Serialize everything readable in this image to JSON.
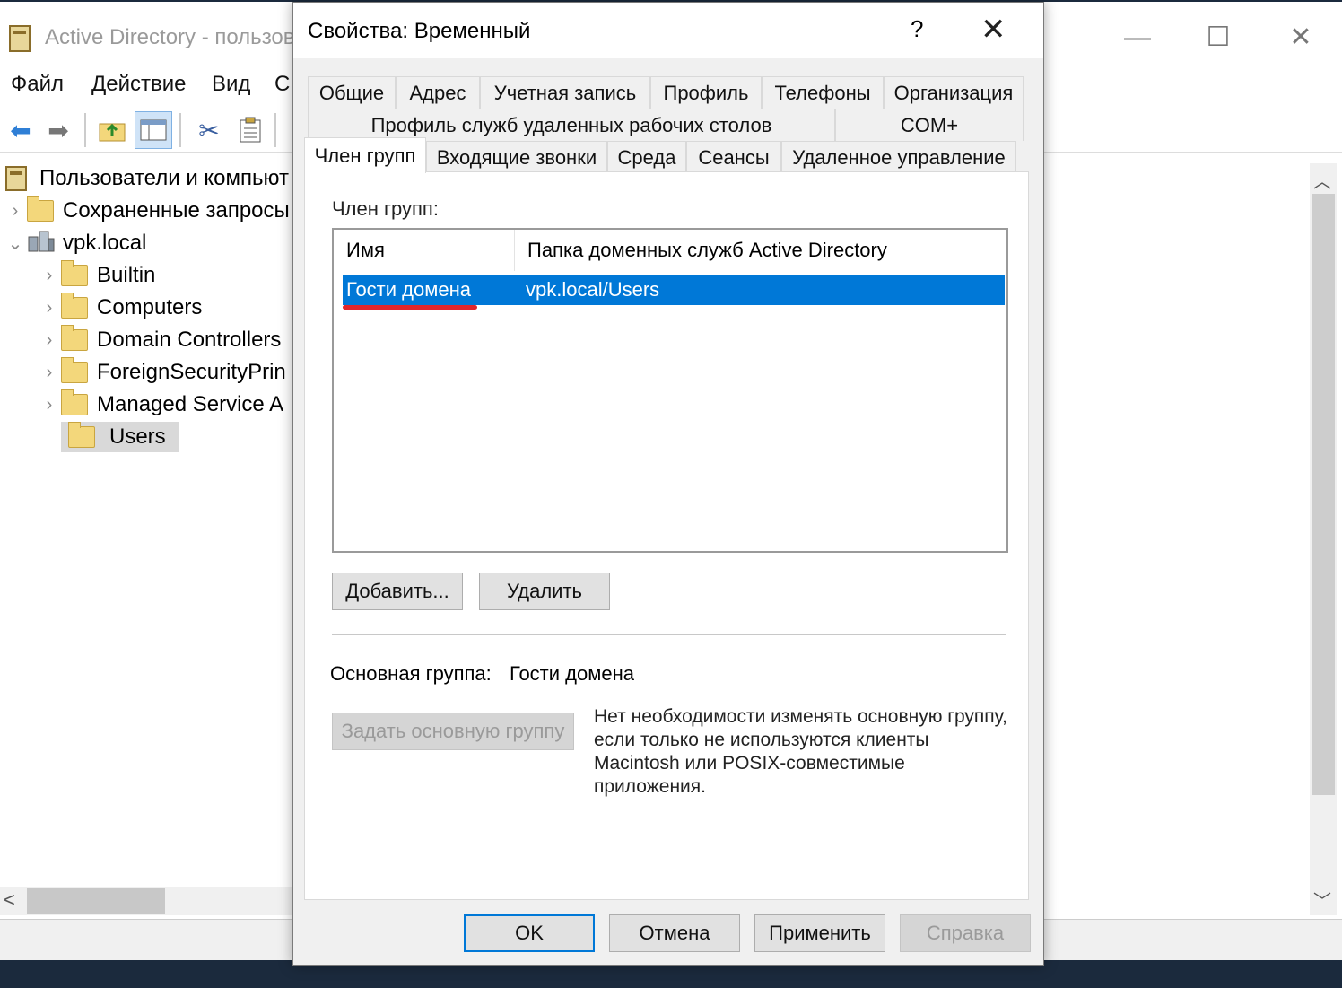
{
  "main_window": {
    "title": "Active Directory - пользов",
    "controls": {
      "minimize": "—",
      "maximize": "☐",
      "close": "✕"
    },
    "menu": [
      "Файл",
      "Действие",
      "Вид",
      "С"
    ],
    "tree": {
      "root": "Пользователи и компьют",
      "saved_queries": "Сохраненные запросы",
      "domain": "vpk.local",
      "children": [
        "Builtin",
        "Computers",
        "Domain Controllers",
        "ForeignSecurityPrin",
        "Managed Service A",
        "Users"
      ]
    }
  },
  "dialog": {
    "title": "Свойства: Временный",
    "help": "?",
    "close": "✕",
    "tabs_row1": [
      "Общие",
      "Адрес",
      "Учетная запись",
      "Профиль",
      "Телефоны",
      "Организация"
    ],
    "tabs_row2": [
      "Профиль служб удаленных рабочих столов",
      "COM+"
    ],
    "tabs_row3": [
      "Член групп",
      "Входящие звонки",
      "Среда",
      "Сеансы",
      "Удаленное управление"
    ],
    "member_of_label": "Член групп:",
    "list": {
      "columns": [
        "Имя",
        "Папка доменных служб Active Directory"
      ],
      "rows": [
        {
          "name": "Гости домена",
          "folder": "vpk.local/Users"
        }
      ]
    },
    "add_button": "Добавить...",
    "remove_button": "Удалить",
    "primary_group_label": "Основная группа:",
    "primary_group_value": "Гости домена",
    "set_primary_button": "Задать основную группу",
    "hint": "Нет необходимости изменять основную группу, если только не используются клиенты Macintosh или POSIX-совместимые приложения.",
    "ok": "OK",
    "cancel": "Отмена",
    "apply": "Применить",
    "help_button": "Справка"
  },
  "colors": {
    "selection": "#0078d7",
    "highlight_underline": "#e0262b",
    "default_button_border": "#0078d7"
  }
}
